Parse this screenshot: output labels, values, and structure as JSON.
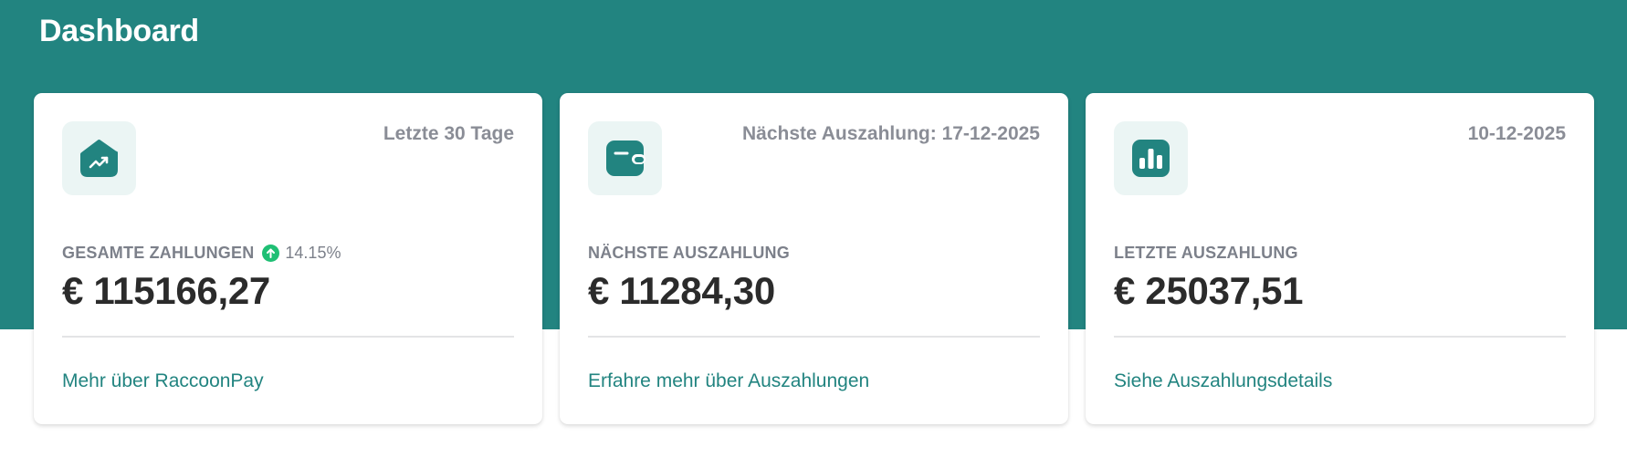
{
  "header": {
    "title": "Dashboard"
  },
  "colors": {
    "brand": "#228480",
    "trend_up": "#1fbf74",
    "icon_bg": "#ebf5f4"
  },
  "cards": [
    {
      "icon": "trending-up-icon",
      "top_right": "Letzte 30 Tage",
      "label": "GESAMTE ZAHLUNGEN",
      "trend": {
        "icon": "arrow-up-icon",
        "value": "14.15%"
      },
      "amount": "€ 115166,27",
      "link": "Mehr über RaccoonPay"
    },
    {
      "icon": "wallet-icon",
      "top_right": "Nächste Auszahlung: 17-12-2025",
      "label": "NÄCHSTE AUSZAHLUNG",
      "amount": "€ 11284,30",
      "link": "Erfahre mehr über Auszahlungen"
    },
    {
      "icon": "bar-chart-icon",
      "top_right": "10-12-2025",
      "label": "LETZTE AUSZAHLUNG",
      "amount": "€ 25037,51",
      "link": "Siehe Auszahlungsdetails"
    }
  ]
}
